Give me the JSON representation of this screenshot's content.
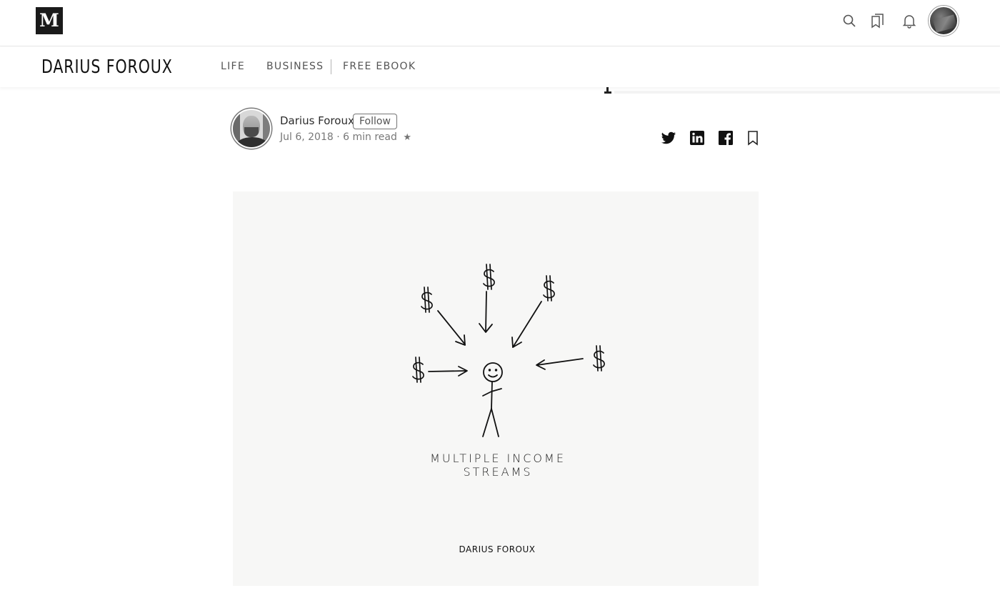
{
  "topbar": {
    "logo_text": "M",
    "icons": [
      "search-icon",
      "bookmarks-icon",
      "bell-icon"
    ]
  },
  "publication": {
    "title": "DARIUS FOROUX",
    "nav": [
      {
        "label": "LIFE"
      },
      {
        "label": "BUSINESS"
      },
      {
        "label": "FREE EBOOK"
      }
    ]
  },
  "author": {
    "name": "Darius Foroux",
    "follow_label": "Follow",
    "date": "Jul 6, 2018",
    "separator": "·",
    "read_time": "6 min read",
    "star": "★"
  },
  "share": {
    "icons": [
      "twitter-icon",
      "linkedin-icon",
      "facebook-icon",
      "bookmark-icon"
    ]
  },
  "hero": {
    "caption": "MULTIPLE INCOME STREAMS",
    "signature": "DARIUS FOROUX",
    "dollar_symbol": "$"
  },
  "colors": {
    "text_primary": "rgba(0,0,0,0.84)",
    "text_secondary": "rgba(0,0,0,0.54)",
    "logo_bg": "#1a1a1a",
    "hero_bg": "#f7f7f6"
  }
}
